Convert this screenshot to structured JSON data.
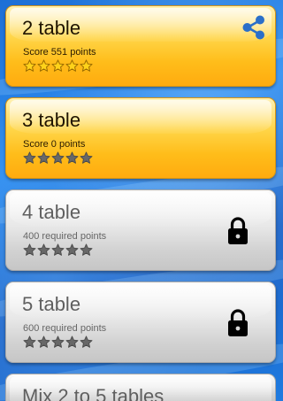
{
  "levels": [
    {
      "title": "2 table",
      "subtitle": "Score 551 points",
      "stars_filled": 5,
      "locked": false,
      "shareable": true
    },
    {
      "title": "3 table",
      "subtitle": "Score 0 points",
      "stars_filled": 0,
      "locked": false,
      "shareable": false
    },
    {
      "title": "4 table",
      "subtitle": "400 required points",
      "stars_filled": 0,
      "locked": true,
      "shareable": false
    },
    {
      "title": "5 table",
      "subtitle": "600 required points",
      "stars_filled": 0,
      "locked": true,
      "shareable": false
    },
    {
      "title": "Mix 2 to 5 tables",
      "subtitle": "",
      "stars_filled": 0,
      "locked": true,
      "shareable": false
    }
  ],
  "icons": {
    "share": "share-icon",
    "lock": "lock-icon",
    "star": "star-icon"
  },
  "colors": {
    "unlocked_card": "#ffc21f",
    "locked_card": "#dedede",
    "star_filled": "#ffd21a",
    "star_empty": "#686868",
    "share_icon": "#2a6fc9",
    "background": "#2d8cf0"
  }
}
